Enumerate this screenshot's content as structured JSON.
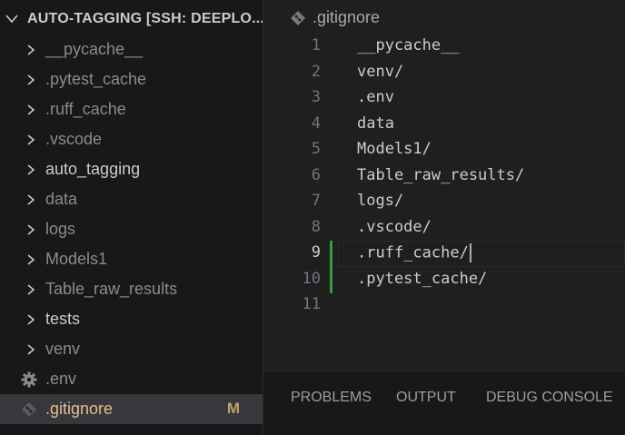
{
  "explorer": {
    "title": "AUTO-TAGGING [SSH: DEEPLO...",
    "items": [
      {
        "label": "__pycache__",
        "kind": "folder",
        "style": "dim"
      },
      {
        "label": ".pytest_cache",
        "kind": "folder",
        "style": "dim"
      },
      {
        "label": ".ruff_cache",
        "kind": "folder",
        "style": "dim"
      },
      {
        "label": ".vscode",
        "kind": "folder",
        "style": "dim"
      },
      {
        "label": "auto_tagging",
        "kind": "folder",
        "style": "bright"
      },
      {
        "label": "data",
        "kind": "folder",
        "style": "dim"
      },
      {
        "label": "logs",
        "kind": "folder",
        "style": "dim"
      },
      {
        "label": "Models1",
        "kind": "folder",
        "style": "dim"
      },
      {
        "label": "Table_raw_results",
        "kind": "folder",
        "style": "dim"
      },
      {
        "label": "tests",
        "kind": "folder",
        "style": "bright"
      },
      {
        "label": "venv",
        "kind": "folder",
        "style": "dim"
      },
      {
        "label": ".env",
        "kind": "file-gear",
        "style": "dim"
      },
      {
        "label": ".gitignore",
        "kind": "file-git",
        "style": "git",
        "status": "M"
      }
    ]
  },
  "editor": {
    "breadcrumb": ".gitignore",
    "lines": [
      {
        "n": "1",
        "text": "__pycache__"
      },
      {
        "n": "2",
        "text": "venv/"
      },
      {
        "n": "3",
        "text": ".env"
      },
      {
        "n": "4",
        "text": "data"
      },
      {
        "n": "5",
        "text": "Models1/"
      },
      {
        "n": "6",
        "text": "Table_raw_results/"
      },
      {
        "n": "7",
        "text": "logs/"
      },
      {
        "n": "8",
        "text": ".vscode/"
      },
      {
        "n": "9",
        "text": ".ruff_cache/"
      },
      {
        "n": "10",
        "text": ".pytest_cache/"
      },
      {
        "n": "11",
        "text": ""
      }
    ]
  },
  "panel": {
    "tabs": [
      "PROBLEMS",
      "OUTPUT",
      "DEBUG CONSOLE"
    ]
  },
  "colors": {
    "git_modified": "#e2c08d",
    "gutter_added": "#2ea043",
    "selected_row": "#37373d"
  }
}
